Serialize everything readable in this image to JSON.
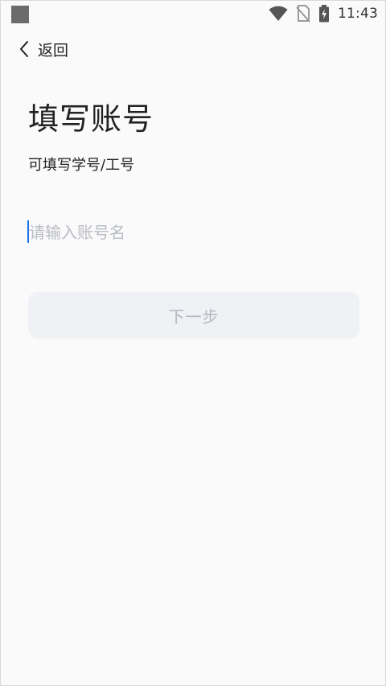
{
  "status_bar": {
    "time": "11:43",
    "icons": [
      "wifi-icon",
      "no-sim-icon",
      "battery-charging-icon"
    ]
  },
  "nav": {
    "back_label": "返回",
    "back_icon": "chevron-left-icon"
  },
  "page": {
    "title": "填写账号",
    "hint": "可填写学号/工号"
  },
  "form": {
    "account_input": {
      "value": "",
      "placeholder": "请输入账号名"
    },
    "next_button_label": "下一步"
  },
  "colors": {
    "background": "#fafafa",
    "button_bg_disabled": "#f0f1f5",
    "button_text_disabled": "#b4b7c0",
    "placeholder": "#b9bcc4",
    "caret": "#1a73e8"
  }
}
